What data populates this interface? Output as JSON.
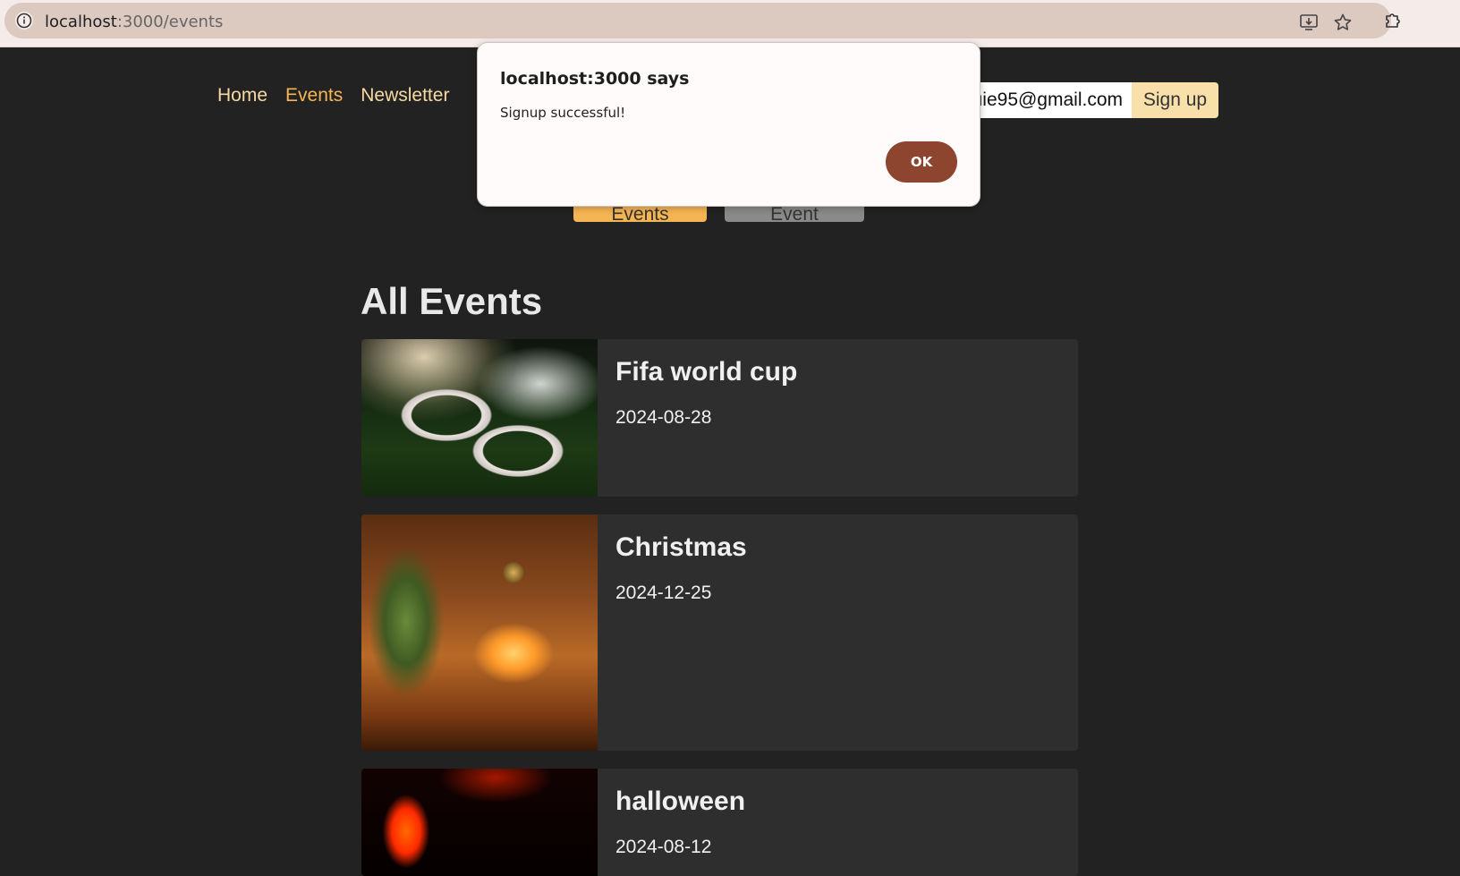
{
  "browser": {
    "url_host": "localhost",
    "url_path": ":3000/events",
    "icons": [
      "info-icon",
      "install-app-icon",
      "bookmark-star-icon",
      "extensions-icon"
    ]
  },
  "nav": {
    "items": [
      {
        "label": "Home"
      },
      {
        "label": "Events"
      },
      {
        "label": "Newsletter"
      }
    ],
    "active": "Events"
  },
  "newsletter": {
    "email_value": "uie95@gmail.com",
    "signup_label": "Sign up"
  },
  "subnav": {
    "all_events_label": "All Events",
    "new_event_label": "New Event"
  },
  "main": {
    "heading": "All Events",
    "events": [
      {
        "title": "Fifa world cup",
        "date": "2024-08-28"
      },
      {
        "title": "Christmas",
        "date": "2024-12-25"
      },
      {
        "title": "halloween",
        "date": "2024-08-12"
      }
    ]
  },
  "dialog": {
    "title": "localhost:3000 says",
    "message": "Signup successful!",
    "ok_label": "OK"
  },
  "colors": {
    "page_bg": "#222222",
    "accent": "#f6b553",
    "nav_link": "#f6d9a2",
    "card_bg": "#2f2e2e",
    "dialog_button": "#8e4530"
  }
}
